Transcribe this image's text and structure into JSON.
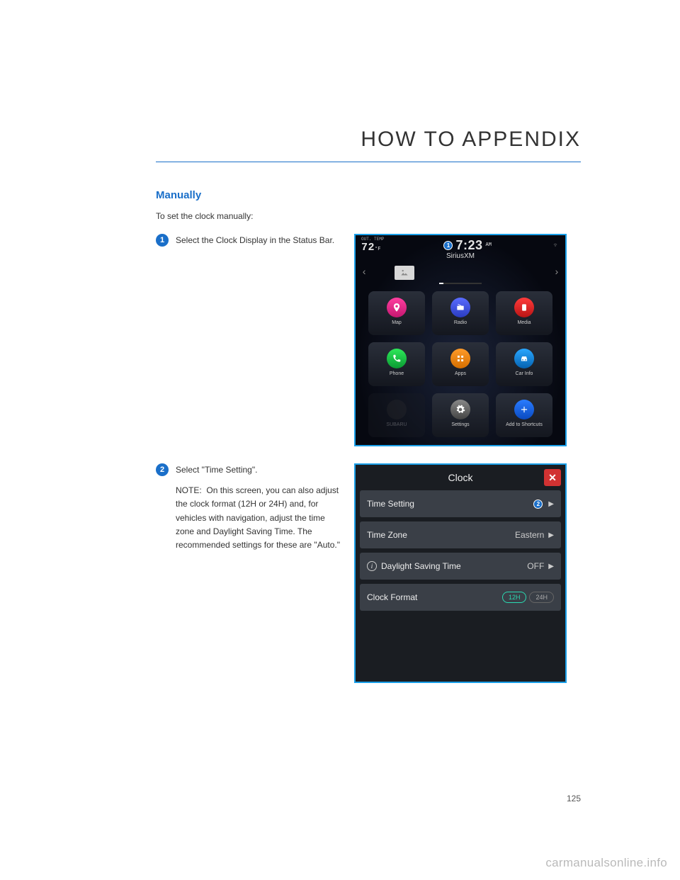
{
  "chapter": "HOW TO APPENDIX",
  "section_title": "Manually",
  "intro": "To set the clock manually:",
  "steps": [
    {
      "num": "1",
      "text": "Select the Clock Display in the Status Bar."
    },
    {
      "num": "2",
      "text": "Select \"Time Setting\".",
      "note_label": "NOTE:",
      "note": "On this screen, you can also adjust the clock format (12H or 24H) and, for vehicles with navigation, adjust the time zone and Daylight Saving Time. The recommended settings for these are \"Auto.\""
    }
  ],
  "screenshot1": {
    "out_temp_label": "OUT. TEMP",
    "temp": "72",
    "temp_unit": "°F",
    "time": "7:23",
    "ampm": "AM",
    "callout": "1",
    "source": "SiriusXM",
    "apps": {
      "map": "Map",
      "radio": "Radio",
      "media": "Media",
      "phone": "Phone",
      "apps": "Apps",
      "car_info": "Car Info",
      "subaru": "SUBARU",
      "settings": "Settings",
      "shortcuts": "Add to Shortcuts"
    }
  },
  "screenshot2": {
    "title": "Clock",
    "callout": "2",
    "rows": {
      "time_setting": "Time Setting",
      "time_zone": "Time Zone",
      "time_zone_value": "Eastern",
      "dst": "Daylight Saving Time",
      "dst_value": "OFF",
      "clock_format": "Clock Format",
      "format_12": "12H",
      "format_24": "24H"
    }
  },
  "page_number": "125",
  "watermark": "carmanualsonline.info"
}
